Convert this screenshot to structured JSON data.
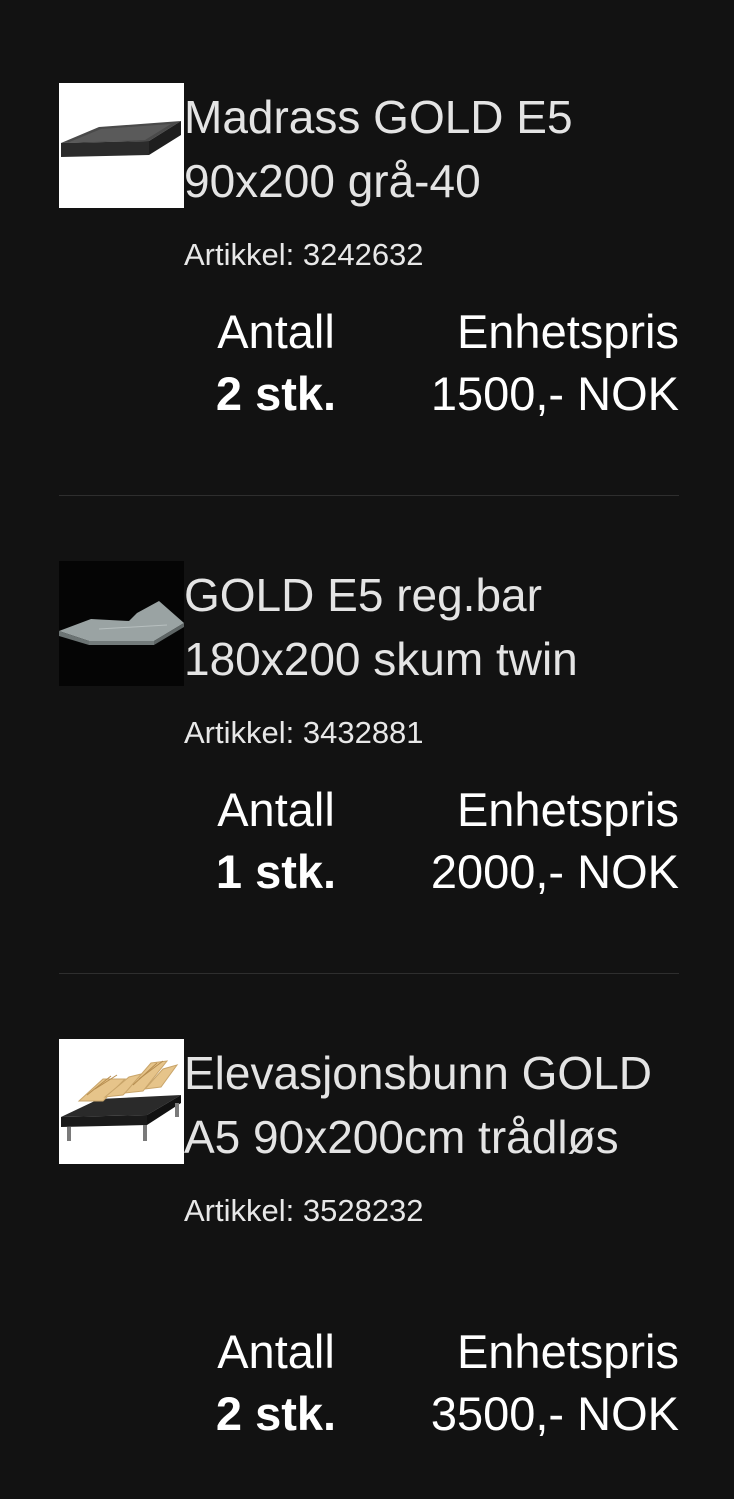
{
  "labels": {
    "quantity": "Antall",
    "unit_price": "Enhetspris"
  },
  "items": [
    {
      "name": "Madrass GOLD E5 90x200 grå-40",
      "article": "Artikkel: 3242632",
      "quantity": "2 stk.",
      "unit_price": "1500,- NOK",
      "image_icon": "mattress-image"
    },
    {
      "name": "GOLD E5 reg.bar 180x200 skum twin",
      "article": "Artikkel: 3432881",
      "quantity": "1 stk.",
      "unit_price": "2000,- NOK",
      "image_icon": "adjustable-topper-image"
    },
    {
      "name": "Elevasjonsbunn GOLD A5 90x200cm trådløs",
      "article": "Artikkel: 3528232",
      "quantity": "2 stk.",
      "unit_price": "3500,- NOK",
      "image_icon": "adjustable-bed-base-image"
    }
  ]
}
